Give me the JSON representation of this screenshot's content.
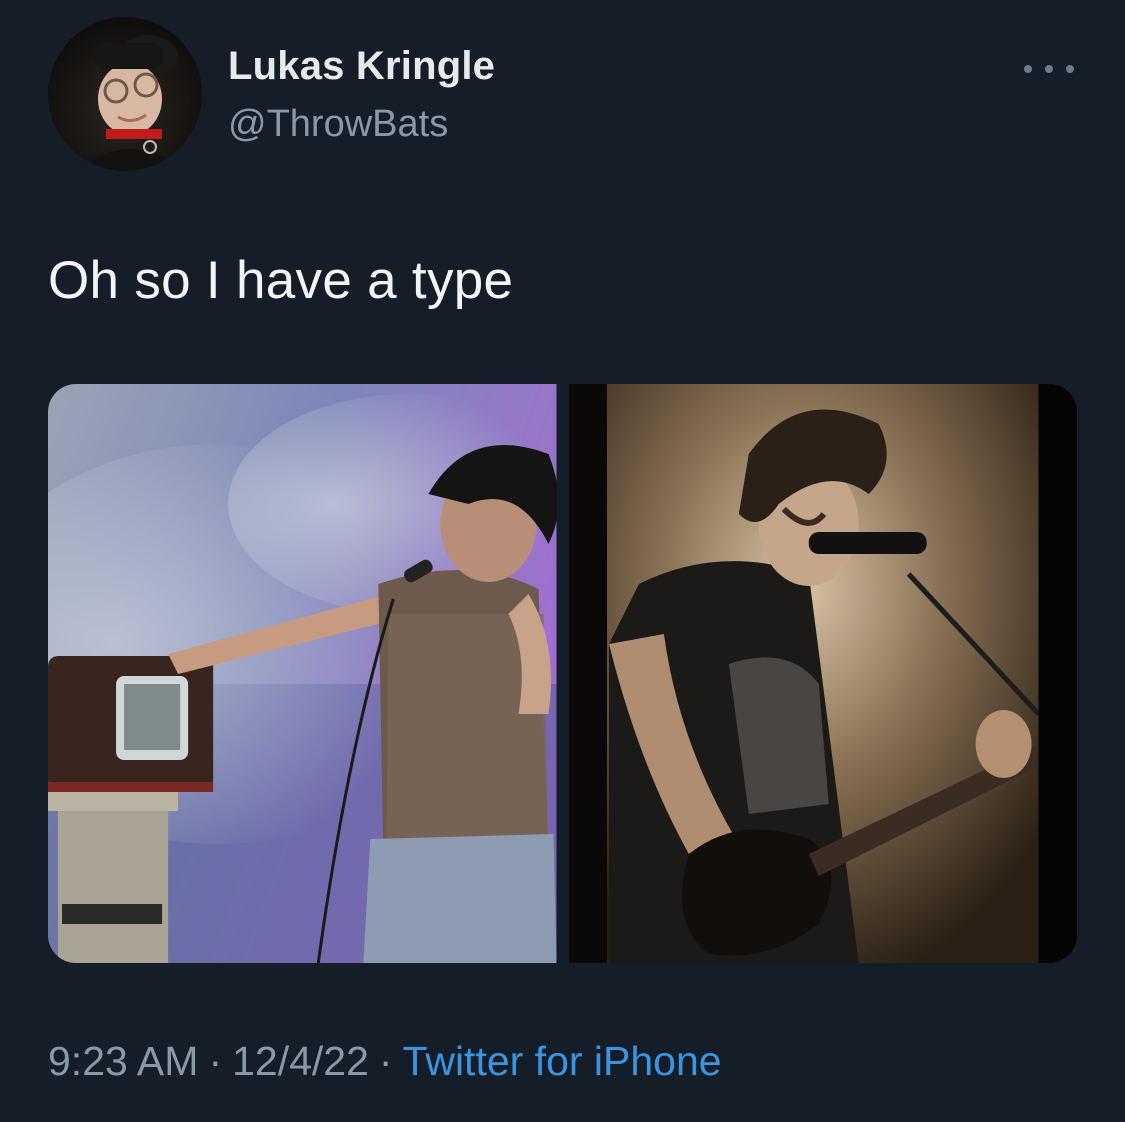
{
  "user": {
    "display_name": "Lukas Kringle",
    "handle": "@ThrowBats",
    "avatar_icon": "profile-photo"
  },
  "header": {
    "more_icon": "more-dots-icon"
  },
  "tweet": {
    "text": "Oh so I have a type"
  },
  "media": {
    "photos": [
      {
        "name": "photo-singer-with-tv"
      },
      {
        "name": "photo-guitarist-with-mic"
      }
    ]
  },
  "meta": {
    "time": "9:23 AM",
    "separator": "·",
    "date": "12/4/22",
    "source": "Twitter for iPhone"
  },
  "colors": {
    "background": "#151d28",
    "text": "#e7e9ea",
    "secondary_text": "#8b98a5",
    "link": "#3b94e0"
  }
}
